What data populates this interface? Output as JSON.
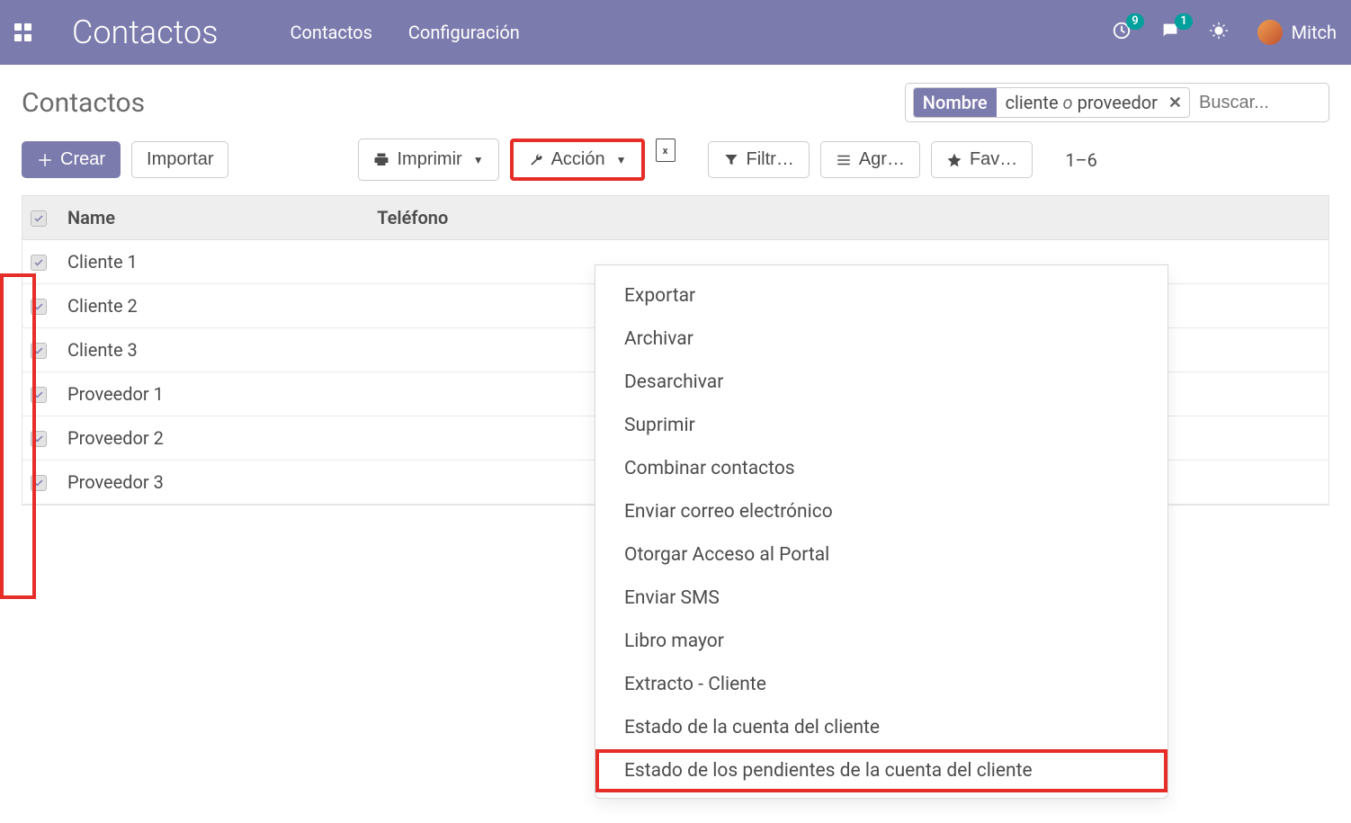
{
  "navbar": {
    "app_title": "Contactos",
    "menu": [
      "Contactos",
      "Configuración"
    ],
    "activity_badge": "9",
    "messages_badge": "1",
    "user_name": "Mitch"
  },
  "breadcrumb": {
    "title": "Contactos"
  },
  "search": {
    "tag_label": "Nombre",
    "tag_value_1": "cliente",
    "tag_or": "o",
    "tag_value_2": "proveedor",
    "placeholder": "Buscar..."
  },
  "toolbar": {
    "create": "Crear",
    "import": "Importar",
    "print": "Imprimir",
    "action": "Acción",
    "filters": "Filtr…",
    "group_by": "Agr…",
    "favorites": "Fav…",
    "pager": "1–6"
  },
  "table": {
    "headers": {
      "name": "Name",
      "phone": "Teléfono"
    },
    "rows": [
      {
        "name": "Cliente 1",
        "phone": ""
      },
      {
        "name": "Cliente 2",
        "phone": ""
      },
      {
        "name": "Cliente 3",
        "phone": ""
      },
      {
        "name": "Proveedor 1",
        "phone": ""
      },
      {
        "name": "Proveedor 2",
        "phone": ""
      },
      {
        "name": "Proveedor 3",
        "phone": ""
      }
    ]
  },
  "action_menu": [
    "Exportar",
    "Archivar",
    "Desarchivar",
    "Suprimir",
    "Combinar contactos",
    "Enviar correo electrónico",
    "Otorgar Acceso al Portal",
    "Enviar SMS",
    "Libro mayor",
    "Extracto - Cliente",
    "Estado de la cuenta del cliente",
    "Estado de los pendientes de la cuenta del cliente"
  ]
}
